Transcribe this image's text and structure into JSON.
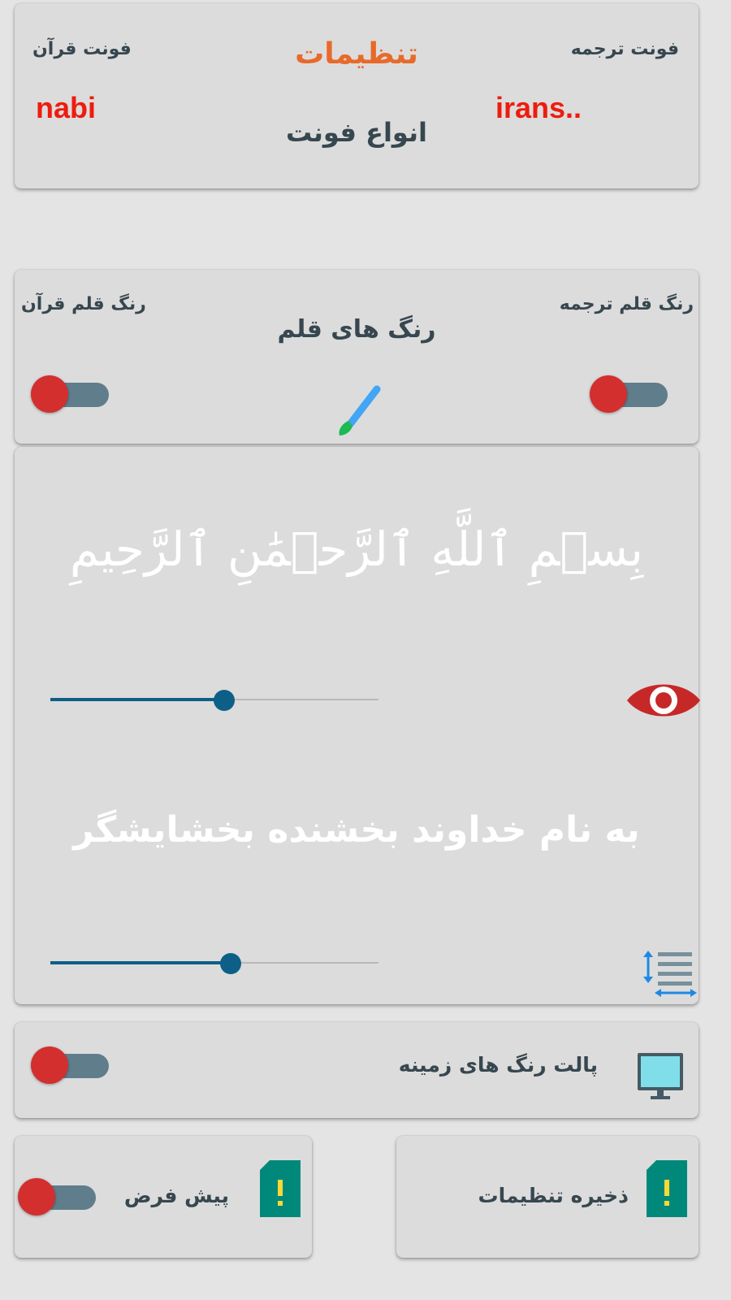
{
  "fonts_card": {
    "title": "تنظیمات",
    "subtitle": "انواع فونت",
    "quran_font_label": "فونت قرآن",
    "quran_font_value": "nabi",
    "translation_font_label": "فونت ترجمه",
    "translation_font_value": "irans.."
  },
  "pen_colors_card": {
    "title": "رنگ های قلم",
    "quran_pen_label": "رنگ قلم قرآن",
    "translation_pen_label": "رنگ قلم ترجمه",
    "quran_pen_toggle_on": false,
    "translation_pen_toggle_on": false,
    "icon": "paint-brush-icon"
  },
  "preview_card": {
    "arabic_text": "بِسۡمِ ٱللَّهِ ٱلرَّحۡمَٰنِ ٱلرَّحِيمِ",
    "translation_text": "به نام خداوند بخشنده بخشایشگر",
    "arabic_size_slider": 0.53,
    "translation_size_slider": 0.55,
    "visibility_icon": "eye-icon",
    "line_spacing_icon": "line-spacing-icon"
  },
  "background_card": {
    "label": "پالت رنگ های زمینه",
    "icon": "monitor-icon",
    "toggle_on": false
  },
  "default_card": {
    "label": "پیش فرض",
    "icon": "sim-card-alert-icon",
    "toggle_on": false
  },
  "save_card": {
    "label": "ذخیره تنظیمات",
    "icon": "sim-card-alert-icon"
  },
  "colors": {
    "accent_orange": "#e8692a",
    "value_red": "#ee1c0e",
    "toggle_thumb": "#d32f2f",
    "toggle_track": "#607d8b",
    "slider_blue": "#0d5f88",
    "card_bg": "#dcdcdc",
    "icon_teal": "#00897b"
  }
}
